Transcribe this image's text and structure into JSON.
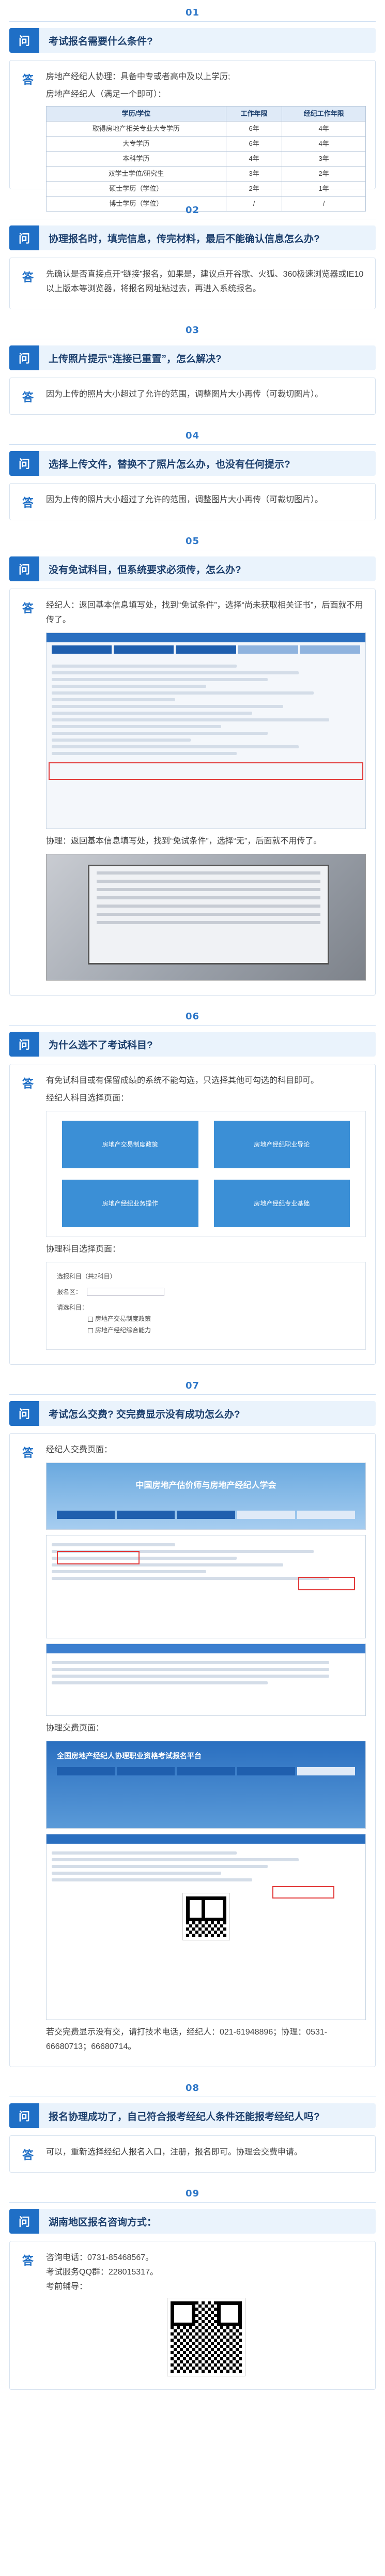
{
  "sections": [
    {
      "num": "01",
      "q": "考试报名需要什么条件?",
      "a_intro": "房地产经纪人协理：具备中专或者高中及以上学历;",
      "a_intro2": "房地产经纪人（满足一个即可）：",
      "table": {
        "headers": [
          "学历/学位",
          "工作年限",
          "经纪工作年限"
        ],
        "rows": [
          [
            "取得房地产相关专业大专学历",
            "6年",
            "4年"
          ],
          [
            "大专学历",
            "6年",
            "4年"
          ],
          [
            "本科学历",
            "4年",
            "3年"
          ],
          [
            "双学士学位/研究生",
            "3年",
            "2年"
          ],
          [
            "硕士学历（学位）",
            "2年",
            "1年"
          ],
          [
            "博士学历（学位）",
            "/",
            "/"
          ]
        ]
      }
    },
    {
      "num": "02",
      "q": "协理报名时，填完信息，传完材料，最后不能确认信息怎么办?",
      "a": "先确认是否直接点开“链接”报名，如果是，建议点开谷歌、火狐、360极速浏览器或IE10以上版本等浏览器，将报名网址粘过去，再进入系统报名。"
    },
    {
      "num": "03",
      "q": "上传照片提示“连接已重置”，怎么解决?",
      "a": "因为上传的照片大小超过了允许的范围，调整图片大小再传（可裁切图片）。"
    },
    {
      "num": "04",
      "q": "选择上传文件，替换不了照片怎么办，也没有任何提示?",
      "a": "因为上传的照片大小超过了允许的范围，调整图片大小再传（可裁切图片）。"
    },
    {
      "num": "05",
      "q": "没有免试科目，但系统要求必须传，怎么办?",
      "a1": "经纪人：返回基本信息填写处，找到“免试条件”，选择“尚未获取相关证书”，后面就不用传了。",
      "a2": "协理：返回基本信息填写处，找到“免试条件”，选择“无”，后面就不用传了。"
    },
    {
      "num": "06",
      "q": "为什么选不了考试科目?",
      "a1": "有免试科目或有保留成绩的系统不能勾选，只选择其他可勾选的科目即可。",
      "a2": "经纪人科目选择页面：",
      "cards": [
        "房地产交易制度政策",
        "房地产经纪职业导论",
        "房地产经纪业务操作",
        "房地产经纪专业基础"
      ],
      "a3": "协理科目选择页面：",
      "form_title": "选报科目（共2科目）",
      "form_label": "报名区：",
      "form_label2": "请选科目：",
      "form_opt1": "房地产交易制度政策",
      "form_opt2": "房地产经纪综合能力"
    },
    {
      "num": "07",
      "q": "考试怎么交费? 交完费显示没有成功怎么办?",
      "a1": "经纪人交费页面：",
      "banner1": "中国房地产估价师与房地产经纪人学会",
      "a2": "协理交费页面：",
      "banner2": "全国房地产经纪人协理职业资格考试报名平台",
      "a3": "若交完费显示没有交，请打技术电话，经纪人：021-61948896；协理：0531-66680713；66680714。"
    },
    {
      "num": "08",
      "q": "报名协理成功了，自己符合报考经纪人条件还能报考经纪人吗?",
      "a": "可以，重新选择经纪人报名入口，注册，报名即可。协理会交费申请。"
    },
    {
      "num": "09",
      "q": "湖南地区报名咨询方式：",
      "a1": "咨询电话：0731-85468567。",
      "a2": "考试服务QQ群：228015317。",
      "a3": "考前辅导："
    }
  ],
  "labels": {
    "q": "问",
    "a": "答"
  }
}
